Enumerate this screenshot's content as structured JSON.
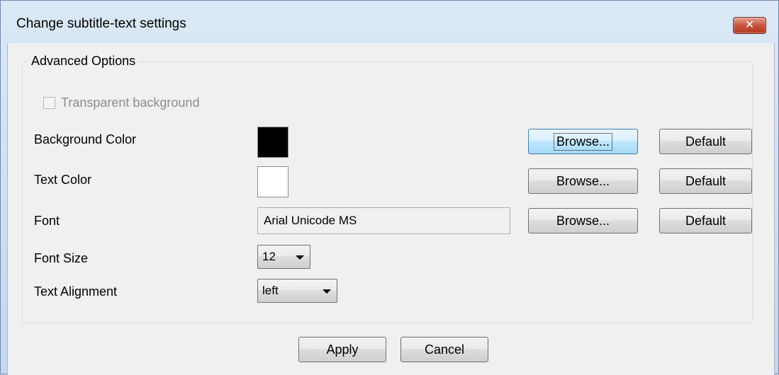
{
  "window": {
    "title": "Change subtitle-text settings",
    "close_label": "✕"
  },
  "group": {
    "legend": "Advanced Options"
  },
  "transparent": {
    "label": "Transparent background",
    "checked": false,
    "enabled": false
  },
  "rows": {
    "background_color": {
      "label": "Background Color",
      "swatch_color": "#000000",
      "browse_label": "Browse...",
      "default_label": "Default"
    },
    "text_color": {
      "label": "Text Color",
      "swatch_color": "#ffffff",
      "browse_label": "Browse...",
      "default_label": "Default"
    },
    "font": {
      "label": "Font",
      "value": "Arial Unicode MS",
      "browse_label": "Browse...",
      "default_label": "Default"
    },
    "font_size": {
      "label": "Font Size",
      "value": "12"
    },
    "text_alignment": {
      "label": "Text Alignment",
      "value": "left"
    }
  },
  "footer": {
    "apply_label": "Apply",
    "cancel_label": "Cancel"
  },
  "colors": {
    "accent": "#3c7fb1",
    "close_button": "#c8523b"
  }
}
